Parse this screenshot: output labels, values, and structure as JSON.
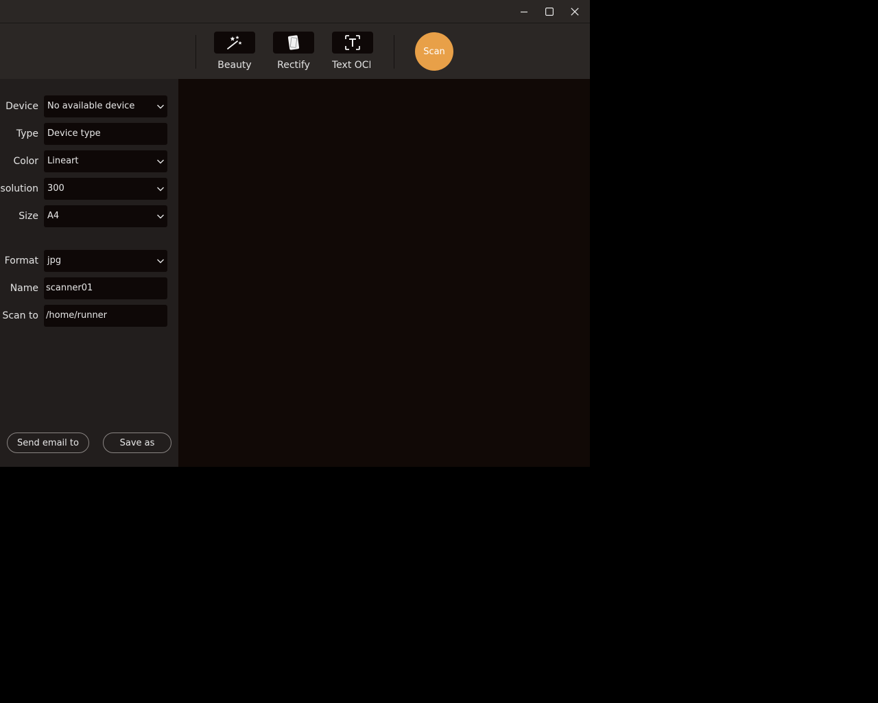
{
  "toolbar": {
    "tools": [
      {
        "label": "Beauty",
        "icon": "magic-wand-icon"
      },
      {
        "label": "Rectify",
        "icon": "rectify-icon"
      },
      {
        "label": "Text OCR",
        "icon": "text-ocr-icon"
      }
    ],
    "scan_label": "Scan"
  },
  "form": {
    "device": {
      "label": "Device",
      "value": "No available device"
    },
    "type": {
      "label": "Type",
      "value": "Device type"
    },
    "color": {
      "label": "Color",
      "value": "Lineart"
    },
    "resolution": {
      "label": "Resolution",
      "value": "300"
    },
    "size": {
      "label": "Size",
      "value": "A4"
    },
    "format": {
      "label": "Format",
      "value": "jpg"
    },
    "name": {
      "label": "Name",
      "value": "scanner01"
    },
    "scan_to": {
      "label": "Scan to",
      "value": "/home/runner"
    }
  },
  "actions": {
    "send_email": "Send email to",
    "save_as": "Save as"
  },
  "colors": {
    "accent": "#e8a048",
    "window_bg": "#221e1d",
    "toolbar_bg": "#2b2725",
    "preview_bg": "#110906",
    "field_bg": "#0e0807"
  }
}
